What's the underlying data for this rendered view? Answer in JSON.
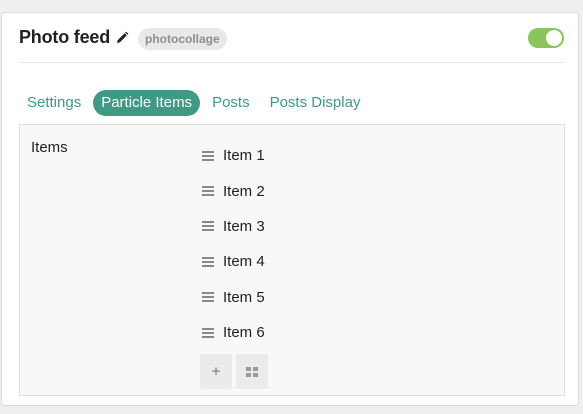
{
  "header": {
    "title": "Photo feed",
    "badge": "photocollage",
    "toggle_on": true,
    "toggle_color": "#8ac45b"
  },
  "tabs": [
    {
      "label": "Settings",
      "active": false
    },
    {
      "label": "Particle Items",
      "active": true
    },
    {
      "label": "Posts",
      "active": false
    },
    {
      "label": "Posts Display",
      "active": false
    }
  ],
  "accent_color": "#3f9983",
  "items_section": {
    "label": "Items",
    "items": [
      "Item 1",
      "Item 2",
      "Item 3",
      "Item 4",
      "Item 5",
      "Item 6"
    ]
  },
  "icons": {
    "edit": "pencil-icon",
    "drag": "drag-handle-icon",
    "add": "plus-icon",
    "collection": "grid-icon"
  }
}
